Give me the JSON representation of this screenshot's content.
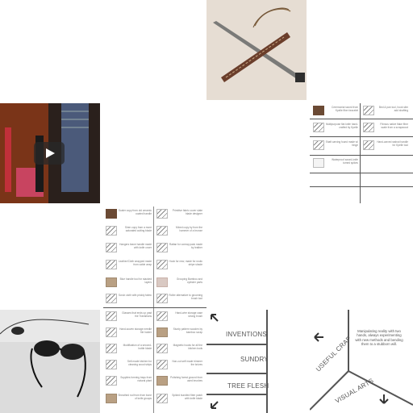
{
  "tiles": {
    "knife_photo": {
      "icon": "photo-knife-sheath"
    },
    "video": {
      "icon": "play-icon"
    },
    "small_list": {
      "items": [
        {
          "text": "Ceremonial sword from Kpelle fiber bracelet"
        },
        {
          "text": "Bed & pan tool, hook slim add shafting"
        },
        {
          "text": "Multipurpose flat knife hand-crafted by Kpelle"
        },
        {
          "text": "Fibrous native flake fibre scale from a scrapwood"
        },
        {
          "text": "Shaft carving found made w/ hinge"
        },
        {
          "text": "Hand-carved walnut handle for Kpelle tool"
        },
        {
          "text": "Waterproof sword-knife turned spikes"
        }
      ]
    },
    "big_list": {
      "items": [
        {
          "text": "Scaler copy from old ceramic coated handle"
        },
        {
          "text": "Primitive fabric cover slate blade designer"
        },
        {
          "text": "Siren copy from a more saturated cutting blade"
        },
        {
          "text": "Mixed copy by from the hammer of a bronze"
        },
        {
          "text": "Hangers leave handle made with knife cover"
        },
        {
          "text": "Rattan for coreap pack made by leather"
        },
        {
          "text": "Leather/Cloth wrapped made from cable wrap"
        },
        {
          "text": "Hook for new, made for rustic stripe shade"
        },
        {
          "text": "Blue handle tool for stacked layers"
        },
        {
          "text": "Grouping Bamboo and cylinder parts"
        },
        {
          "text": "Scrub cloth with prickly fabric"
        },
        {
          "text": "Roller alternative to grooming brush tool"
        },
        {
          "text": "Glasses that ends up past the Transitions"
        },
        {
          "text": "Hand-wire storage case strong brush"
        },
        {
          "text": "Hand-woven storage needle file holder"
        },
        {
          "text": "Sturdy pattern wooden by bamboo scrap"
        },
        {
          "text": "Modification of a second-bottle blade"
        },
        {
          "text": "Magnetic hooks for all the kitchen tools"
        },
        {
          "text": "Self-made kitchen for cleaning wood strips"
        },
        {
          "text": "Non-cut self made trimmer the knives"
        },
        {
          "text": "Supplies forming trays from natural plant"
        },
        {
          "text": "Polishing forest ground from used brushes"
        },
        {
          "text": "Sheathed rod from from bone of knife groups"
        },
        {
          "text": "Spiked bundled fiber patch with knife blade"
        }
      ]
    },
    "sunglasses_photo": {
      "icon": "photo-sunglasses"
    },
    "category_menu": {
      "items": [
        {
          "label": "INVENTIONS"
        },
        {
          "label": "SUNDRY"
        },
        {
          "label": "TREE FLESH"
        }
      ]
    },
    "triangle_nav": {
      "description": "Manipulating reality with two hands, always experimenting with new methods and bending them to a stubborn will.",
      "left_label": "USEFUL CRAP",
      "right_label": "VISUAL ARTS"
    }
  }
}
